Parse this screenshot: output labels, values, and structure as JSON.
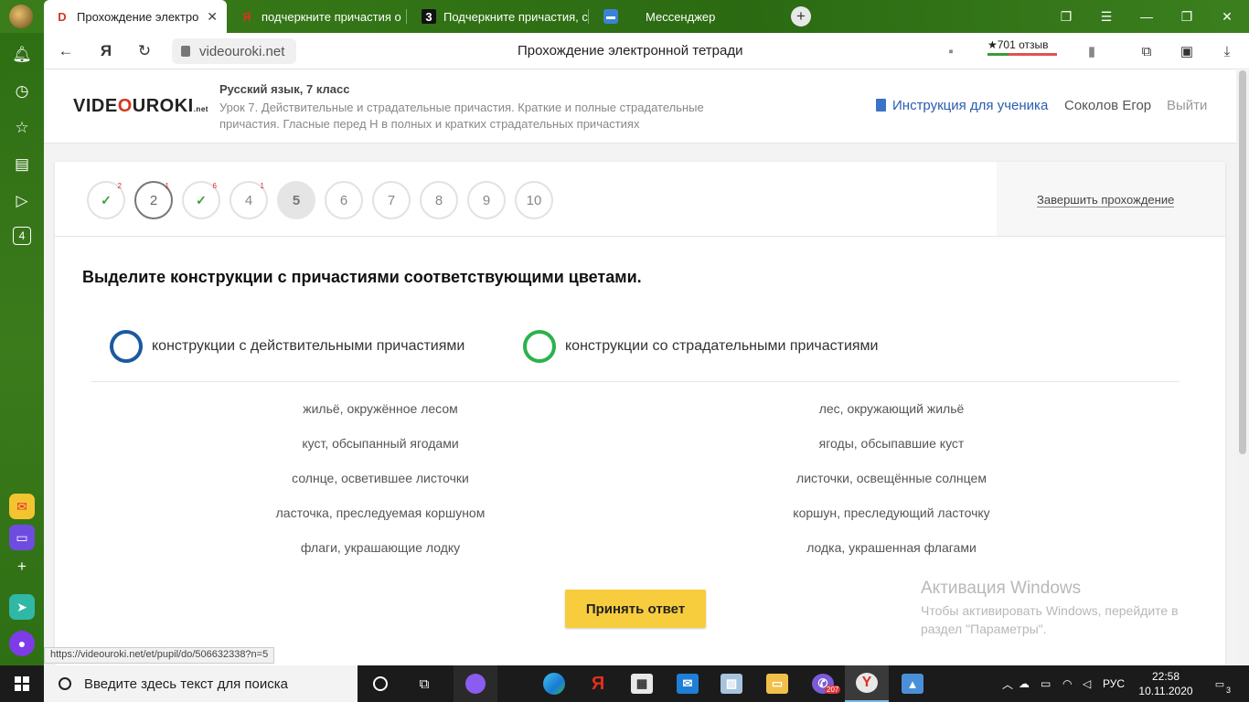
{
  "browser": {
    "tabs": [
      {
        "label": "Прохождение электро",
        "favicon": "D",
        "active": true
      },
      {
        "label": "подчеркните причастия о",
        "favicon": "Я",
        "active": false
      },
      {
        "label": "Подчеркните причастия, с",
        "favicon": "3",
        "active": false
      },
      {
        "label": "Мессенджер",
        "favicon": "chat-icon",
        "active": false
      }
    ],
    "new_tab": "+",
    "url": "videouroki.net",
    "page_title": "Прохождение электронной тетради",
    "reviews_label": "★701 отзыв",
    "status_url": "https://videouroki.net/et/pupil/do/506632338?n=5"
  },
  "site": {
    "logo_left": "VIDE",
    "logo_o": "O",
    "logo_right": "UROKI",
    "logo_suffix": ".net",
    "subject": "Русский язык, 7 класс",
    "lesson": "Урок 7. Действительные и страдательные причастия. Краткие и полные страдательные причастия. Гласные перед Н в полных и кратких страдательных причастиях",
    "instruction_link": "Инструкция для ученика",
    "user_name": "Соколов Егор",
    "logout": "Выйти"
  },
  "steps": [
    {
      "label": "",
      "state": "done",
      "badge": "2"
    },
    {
      "label": "2",
      "state": "current",
      "badge": "1"
    },
    {
      "label": "",
      "state": "done",
      "badge": "6"
    },
    {
      "label": "4",
      "state": "normal",
      "badge": "1"
    },
    {
      "label": "5",
      "state": "active",
      "badge": ""
    },
    {
      "label": "6",
      "state": "normal",
      "badge": ""
    },
    {
      "label": "7",
      "state": "normal",
      "badge": ""
    },
    {
      "label": "8",
      "state": "normal",
      "badge": ""
    },
    {
      "label": "9",
      "state": "normal",
      "badge": ""
    },
    {
      "label": "10",
      "state": "normal",
      "badge": ""
    }
  ],
  "finish_link": "Завершить прохождение",
  "task": {
    "question": "Выделите конструкции с причастиями соответствующими цветами.",
    "legend": [
      {
        "label": "конструкции с действительными причастиями",
        "color": "#1a5aa0"
      },
      {
        "label": "конструкции со страдательными причастиями",
        "color": "#2bb34a"
      }
    ],
    "left_column": [
      "жильё, окружённое лесом",
      "куст, обсыпанный ягодами",
      "солнце, осветившее листочки",
      "ласточка, преследуемая коршуном",
      "флаги, украшающие лодку"
    ],
    "right_column": [
      "лес, окружающий жильё",
      "ягоды, обсыпавшие куст",
      "листочки, освещённые солнцем",
      "коршун, преследующий ласточку",
      "лодка, украшенная флагами"
    ],
    "submit_label": "Принять ответ"
  },
  "watermark": {
    "title": "Активация Windows",
    "subtitle": "Чтобы активировать Windows, перейдите в раздел \"Параметры\"."
  },
  "taskbar": {
    "search_placeholder": "Введите здесь текст для поиска",
    "language": "РУС",
    "time": "22:58",
    "date": "10.11.2020",
    "viber_badge": "207",
    "notifications": "3"
  },
  "sidebar_badge": "4",
  "colors": {
    "accent_yellow": "#f7cd3d",
    "browser_green": "#2f6e12"
  }
}
